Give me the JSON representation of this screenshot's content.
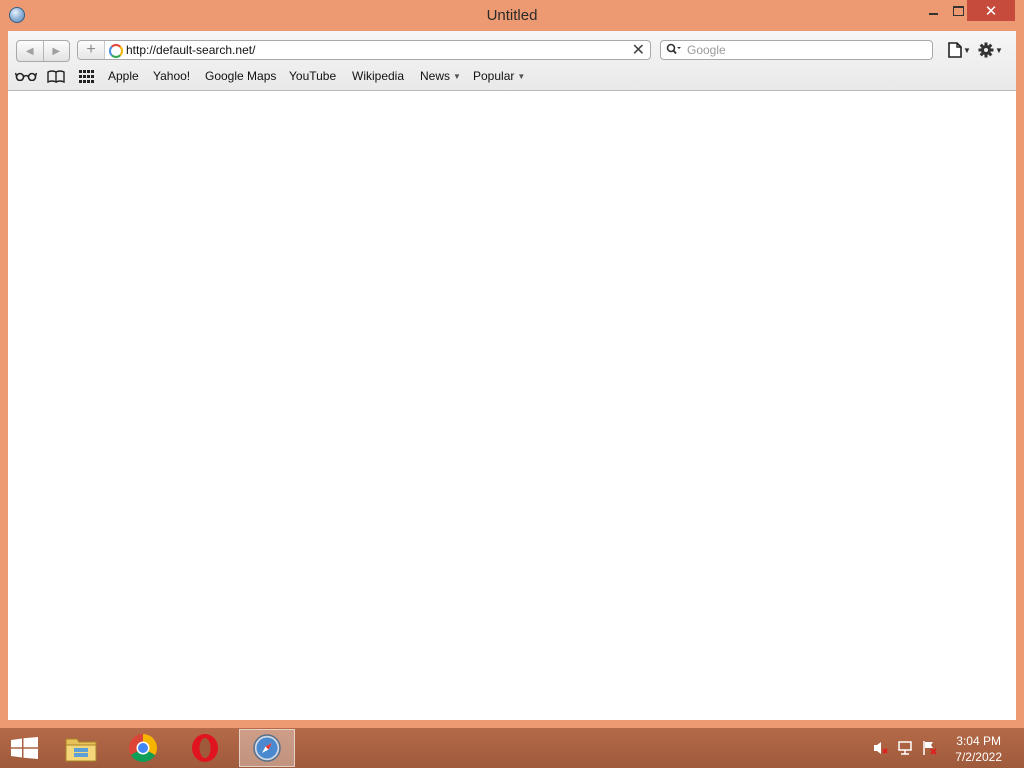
{
  "window": {
    "title": "Untitled",
    "close_label": "✕"
  },
  "toolbar": {
    "back_icon": "back-arrow-icon",
    "forward_icon": "forward-arrow-icon",
    "add_icon": "plus-icon",
    "address": "http://default-search.net/",
    "search_placeholder": "Google"
  },
  "bookmarks": {
    "items": [
      {
        "label": "Apple"
      },
      {
        "label": "Yahoo!"
      },
      {
        "label": "Google Maps"
      },
      {
        "label": "YouTube"
      },
      {
        "label": "Wikipedia"
      },
      {
        "label": "News",
        "dropdown": true
      },
      {
        "label": "Popular",
        "dropdown": true
      }
    ]
  },
  "taskbar": {
    "apps": [
      "file-explorer",
      "chrome",
      "opera",
      "safari"
    ],
    "active_app": "safari",
    "clock_time": "3:04 PM",
    "clock_date": "7/2/2022"
  },
  "colors": {
    "frame": "#ed9a73",
    "close_button": "#c74b3c",
    "taskbar": "#a85f40"
  }
}
